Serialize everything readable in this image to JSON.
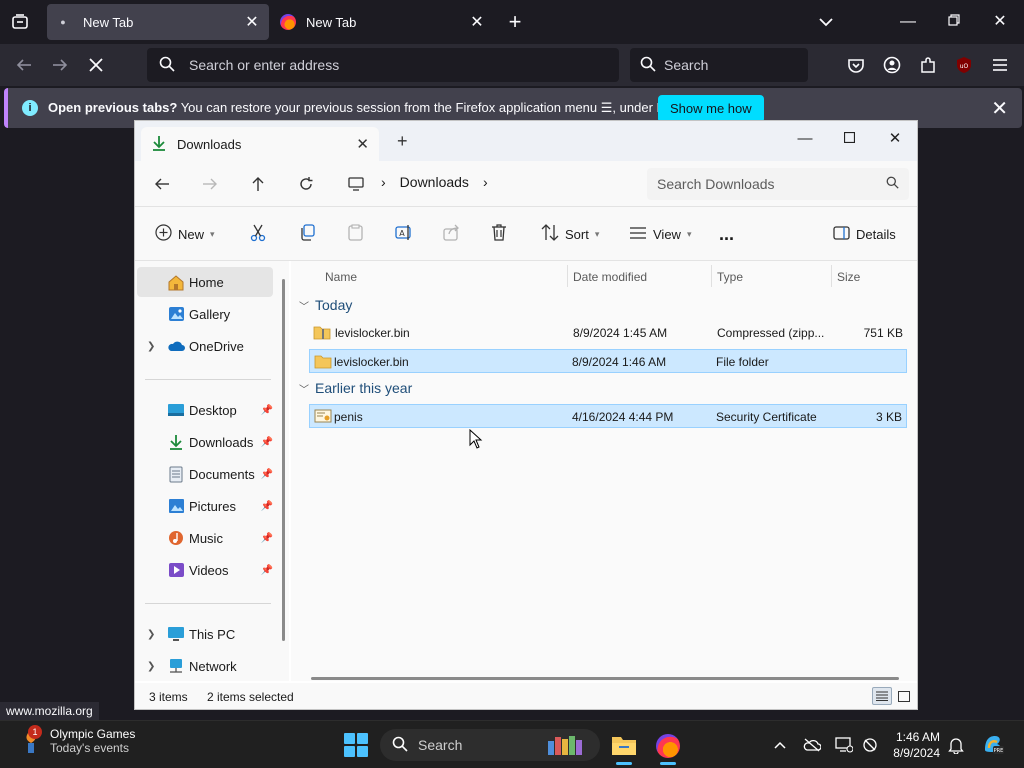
{
  "firefox": {
    "tabs": [
      {
        "title": "New Tab",
        "active": true
      },
      {
        "title": "New Tab",
        "active": false
      }
    ],
    "urlbar_placeholder": "Search or enter address",
    "search_placeholder": "Search",
    "notification": {
      "bold": "Open previous tabs?",
      "text_before_icon": " You can restore your previous session from the Firefox application menu ",
      "text_after_icon": ", under History.",
      "button": "Show me how"
    },
    "status_url": "www.mozilla.org",
    "colors": {
      "accent": "#00ddff",
      "chrome": "#2b2a33",
      "background": "#1c1b22",
      "notification_border": "#c084fc"
    }
  },
  "explorer": {
    "tab_title": "Downloads",
    "breadcrumb": [
      "Downloads"
    ],
    "search_placeholder": "Search Downloads",
    "commands": {
      "new": "New",
      "sort": "Sort",
      "view": "View",
      "more": "...",
      "details": "Details"
    },
    "nav": {
      "home": "Home",
      "gallery": "Gallery",
      "onedrive": "OneDrive",
      "desktop": "Desktop",
      "downloads": "Downloads",
      "documents": "Documents",
      "pictures": "Pictures",
      "music": "Music",
      "videos": "Videos",
      "thispc": "This PC",
      "network": "Network"
    },
    "columns": {
      "name": "Name",
      "date": "Date modified",
      "type": "Type",
      "size": "Size"
    },
    "groups": [
      {
        "label": "Today",
        "files": [
          {
            "name": "levislocker.bin",
            "date": "8/9/2024 1:45 AM",
            "type": "Compressed (zipp...",
            "size": "751 KB",
            "icon": "zip-folder-icon",
            "selected": false
          },
          {
            "name": "levislocker.bin",
            "date": "8/9/2024 1:46 AM",
            "type": "File folder",
            "size": "",
            "icon": "folder-icon",
            "selected": true
          }
        ]
      },
      {
        "label": "Earlier this year",
        "files": [
          {
            "name": "penis",
            "date": "4/16/2024 4:44 PM",
            "type": "Security Certificate",
            "size": "3 KB",
            "icon": "certificate-icon",
            "selected": true
          }
        ]
      }
    ],
    "status": {
      "items": "3 items",
      "selected": "2 items selected"
    },
    "colors": {
      "selection": "#cce8ff",
      "selection_border": "#99d1ff",
      "group_text": "#1f4e79"
    }
  },
  "taskbar": {
    "weather_title": "Olympic Games",
    "weather_subtitle": "Today's events",
    "notification_count": "1",
    "search_placeholder": "Search",
    "time": "1:46 AM",
    "date": "8/9/2024",
    "colors": {
      "accent": "#4cc2ff",
      "background": "#202020"
    }
  }
}
